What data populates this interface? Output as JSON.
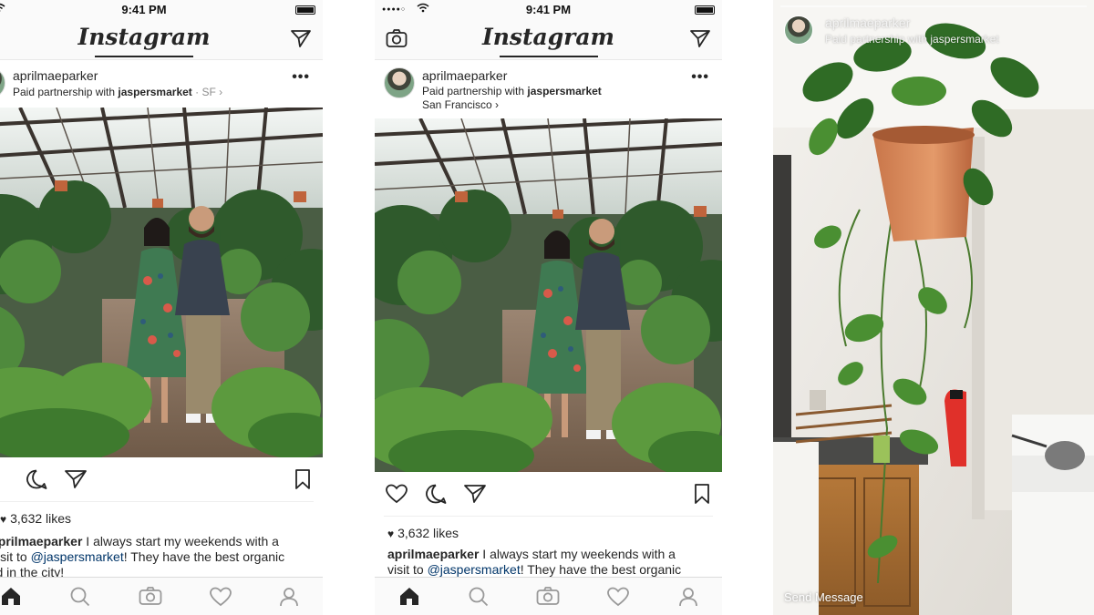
{
  "status_bar": {
    "time": "9:41 PM",
    "signal_dots": "●●●●○"
  },
  "app": {
    "logo": "Instagram"
  },
  "icons": {
    "camera": "camera-icon",
    "direct": "paper-plane-icon",
    "more": "ellipsis-icon",
    "like": "heart-outline-icon",
    "comment": "comment-bubble-icon",
    "share": "paper-plane-icon",
    "save": "bookmark-icon",
    "home": "home-icon",
    "search": "search-icon",
    "tab_camera": "camera-icon",
    "activity": "heart-outline-icon",
    "profile": "profile-icon"
  },
  "colors": {
    "mention": "#003569",
    "text": "#262626",
    "muted": "#8e8e8e"
  },
  "feed_left": {
    "username": "aprilmaeparker",
    "subtitle_prefix": "Paid partnership with ",
    "partner": "jaspersmarket",
    "location_inline": " · SF ›",
    "more": "•••",
    "likes": "3,632 likes",
    "caption_user": "aprilmaeparker",
    "caption_text_1": " I always start my weekends with a",
    "caption_text_2a": "visit to ",
    "caption_mention": "@jaspersmarket",
    "caption_text_2b": "! They have the best organic",
    "caption_text_3": "food in the city!"
  },
  "feed_center": {
    "username": "aprilmaeparker",
    "subtitle_prefix": "Paid partnership with ",
    "partner": "jaspersmarket",
    "location": "San Francisco ›",
    "more": "•••",
    "likes": "3,632 likes",
    "caption_user": "aprilmaeparker",
    "caption_text_1": " I always start my weekends with a",
    "caption_text_2a": "visit to ",
    "caption_mention": "@jaspersmarket",
    "caption_text_2b": "! They have the best organic"
  },
  "story": {
    "username": "aprilmaeparker",
    "subtitle": "Paid partnership with jaspersmarket",
    "send_message": "Send Message"
  }
}
